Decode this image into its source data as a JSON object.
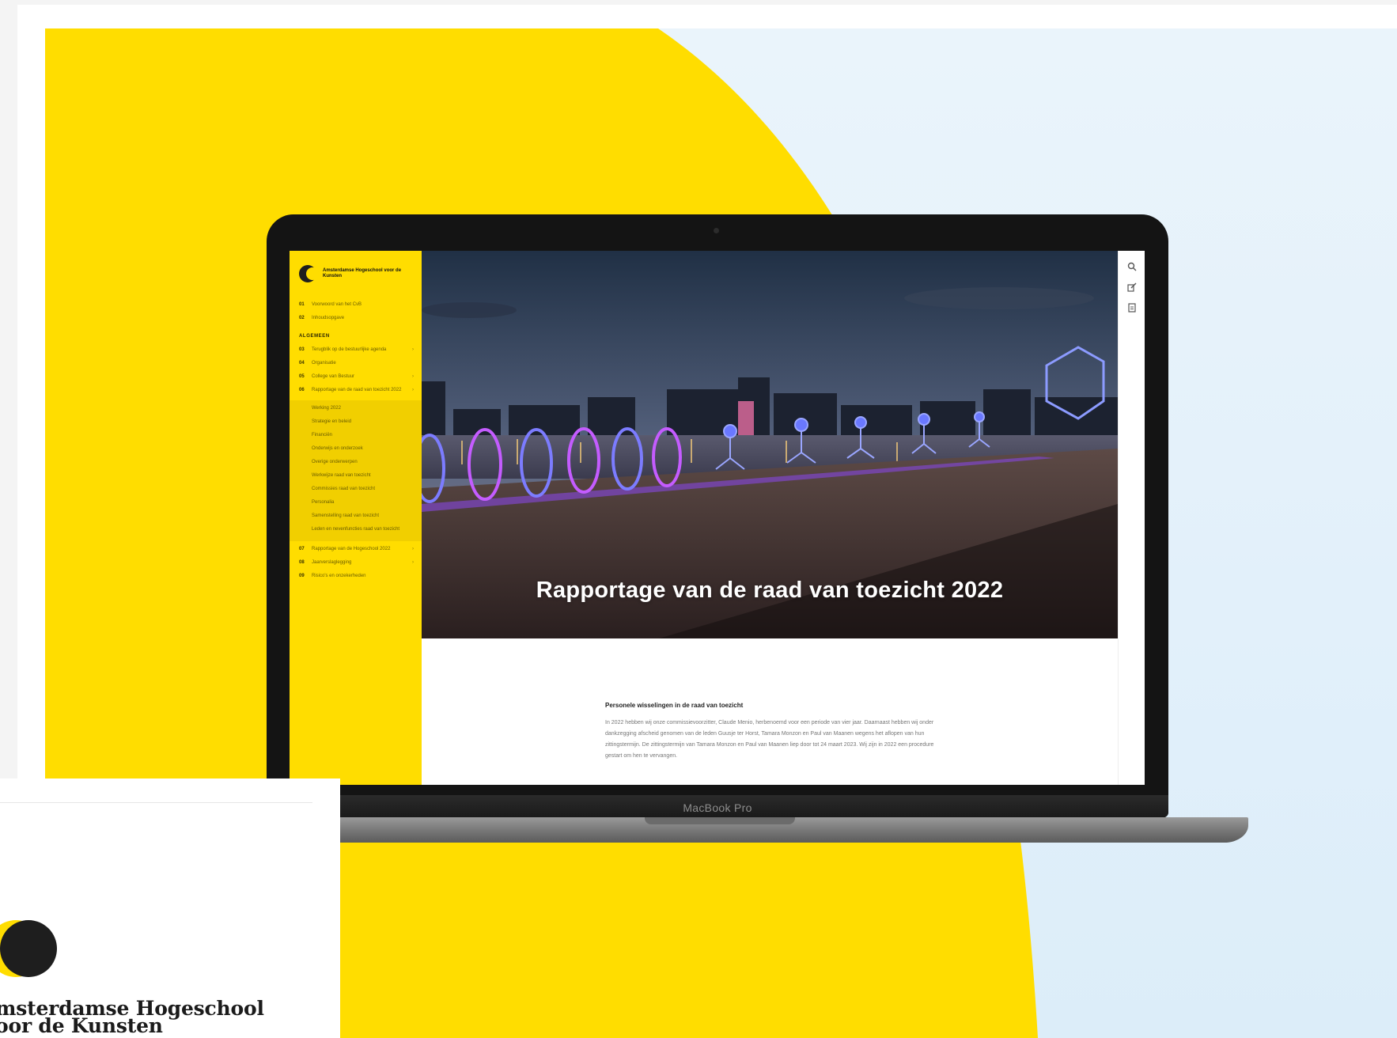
{
  "colors": {
    "brand_yellow": "#ffdd00",
    "background_blue": "#dcedf9",
    "ink": "#1b1b1b"
  },
  "laptop": {
    "model_label": "MacBook Pro"
  },
  "site": {
    "logo_text": "Amsterdamse Hogeschool voor de Kunsten",
    "sidebar": {
      "items_top": [
        {
          "num": "01",
          "label": "Voorwoord van het CvB"
        },
        {
          "num": "02",
          "label": "Inhoudsopgave"
        }
      ],
      "section_label": "ALGEMEEN",
      "items": [
        {
          "num": "03",
          "label": "Terugblik op de bestuurlijke agenda",
          "chevron": "›"
        },
        {
          "num": "04",
          "label": "Organisatie"
        },
        {
          "num": "05",
          "label": "College van Bestuur",
          "chevron": "›"
        },
        {
          "num": "06",
          "label": "Rapportage van de raad van toezicht 2022",
          "chevron": "›"
        }
      ],
      "subitems": [
        "Werking 2022",
        "Strategie en beleid",
        "Financiën",
        "Onderwijs en onderzoek",
        "Overige onderwerpen",
        "Werkwijze raad van toezicht",
        "Commissies raad van toezicht",
        "Personalia",
        "Samenstelling raad van toezicht",
        "Leden en nevenfuncties raad van toezicht"
      ],
      "items_bottom": [
        {
          "num": "07",
          "label": "Rapportage van de Hogeschool 2022",
          "chevron": "›"
        },
        {
          "num": "08",
          "label": "Jaarverslaglegging",
          "chevron": "›"
        },
        {
          "num": "09",
          "label": "Risico's en onzekerheden"
        }
      ]
    },
    "hero_title": "Rapportage van de raad van toezicht 2022",
    "toolbar": {
      "icons": [
        "search-icon",
        "edit-icon",
        "document-icon"
      ]
    },
    "article": {
      "heading": "Personele wisselingen in de raad van toezicht",
      "body": "In 2022 hebben wij onze commissievoorzitter, Claude Menio, herbenoemd voor een periode van vier jaar. Daarnaast hebben wij onder dankzegging afscheid genomen van de leden Guusje ter Horst, Tamara Monzon en Paul van Maanen wegens het aflopen van hun zittingstermijn. De zittingstermijn van Tamara Monzon en Paul van Maanen liep door tot 24 maart 2023. Wij zijn in 2022 een procedure gestart om hen te vervangen."
    }
  },
  "brand_card": {
    "line1": "msterdamse Hogeschool",
    "line2": "oor de Kunsten"
  }
}
